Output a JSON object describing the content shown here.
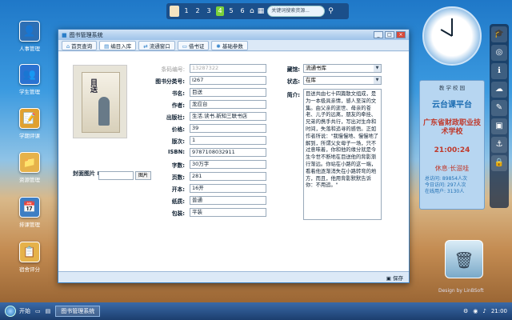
{
  "desktop_icons": [
    {
      "label": "人事管理",
      "glyph": "👤"
    },
    {
      "label": "学生管理",
      "glyph": "👥"
    },
    {
      "label": "学期评课",
      "glyph": "📝"
    },
    {
      "label": "资源管理",
      "glyph": "📁"
    },
    {
      "label": "排课管理",
      "glyph": "📅"
    },
    {
      "label": "宿舍评分",
      "glyph": "📋"
    }
  ],
  "topbar": {
    "pages": [
      "1",
      "2",
      "3",
      "4",
      "5",
      "6"
    ],
    "current_page": "4",
    "search_placeholder": "关键词搜索资源..."
  },
  "window": {
    "title": "图书管理系统",
    "tabs": [
      "首页查询",
      "编目入库",
      "流通窗口",
      "借书证",
      "基础参数"
    ],
    "labels": {
      "id": "条码编号:",
      "class": "图书分类号:",
      "title": "书名:",
      "author": "作者:",
      "publisher": "出版社:",
      "price": "价格:",
      "edition": "版次:",
      "isbn": "ISBN:",
      "words": "字数:",
      "pages": "页数:",
      "format": "开本:",
      "paper": "纸质:",
      "binding": "包装:",
      "location": "藏馆:",
      "status": "状态:",
      "intro": "简介:"
    },
    "values": {
      "id": "13287322",
      "class": "I267",
      "title": "目送",
      "author": "龙应台",
      "publisher": "生活.读书.新知三联书店",
      "price": "39",
      "edition": "1",
      "isbn": "9787108032911",
      "words": "30万字",
      "pages": "281",
      "format": "16开",
      "paper": "普通",
      "binding": "平装",
      "location": "流通书库",
      "status": "在库"
    },
    "intro": "目送共由七十四篇散文组成，是为一本极具亲情，感人至深的文集。由父亲的逝世、母亲的苍老、儿子的远离，朋友的牵挂、兄弟的携手共行，写出对生命和时间，失落和追寻的感悟。正如作者所说：\"我慢慢地、慢慢地了解到，所谓父女母子一场，只不过意味着，你和他的缘分就是今生今世不断地在目送他的背影渐行渐远。你站在小路的这一端，看着他逐渐消失在小路转弯的地方，而且，他用背影默默告诉你：不用追。\"",
    "cover_label": "封面图片 80x100:",
    "cover_btn": "图片",
    "save": "保存"
  },
  "gadget": {
    "header": "教 学 校 园",
    "campus": "云台课平台",
    "school": "广东省财政职业技术学校",
    "time": "21:00:24",
    "slogan": "休息·长滋哇",
    "stat1": "总访问: 89854人次",
    "stat2": "今日访问: 297人次",
    "stat3": "在线用户: 3130人"
  },
  "credit": "Design by LinBSoft",
  "taskbar": {
    "start": "开始",
    "task": "图书管理系统",
    "clock": "21:00"
  }
}
